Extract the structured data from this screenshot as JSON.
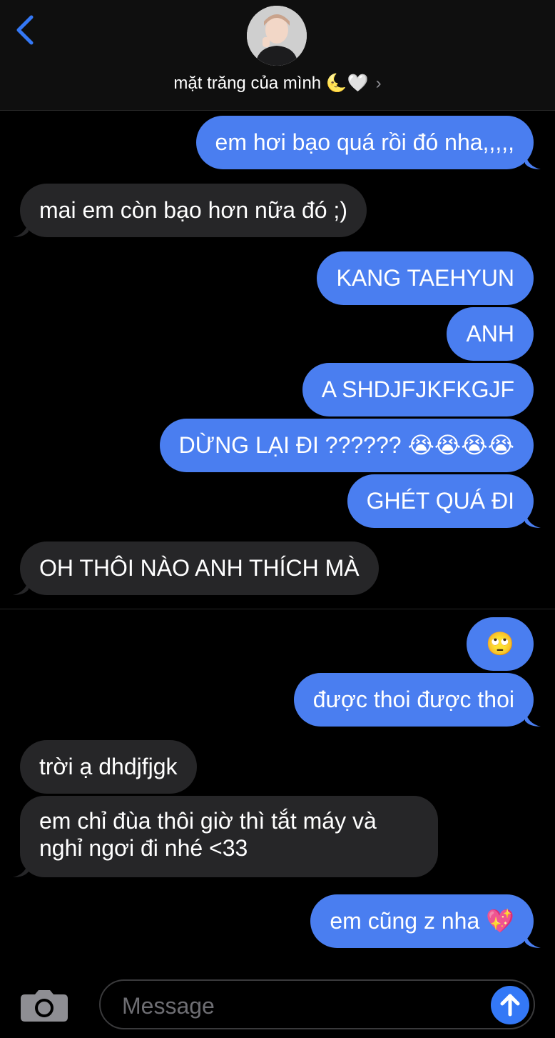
{
  "header": {
    "contact_name": "mặt trăng của mình 🌜🤍",
    "chevron": "›",
    "back_icon": "chevron-left-icon",
    "accent": "#3478f6"
  },
  "messages": [
    {
      "from": "me",
      "text": "em hơi bạo quá rồi đó nha,,,,,"
    },
    {
      "from": "them",
      "text": "mai em còn bạo hơn nữa đó ;)"
    },
    {
      "from": "me",
      "text": "KANG TAEHYUN"
    },
    {
      "from": "me",
      "text": "ANH"
    },
    {
      "from": "me",
      "text": "A SHDJFJKFKGJF"
    },
    {
      "from": "me",
      "text": "DỪNG LẠI ĐI ?????? 😭😭😭😭"
    },
    {
      "from": "me",
      "text": "GHÉT QUÁ ĐI"
    },
    {
      "from": "them",
      "text": "OH THÔI NÀO ANH THÍCH MÀ"
    },
    {
      "from": "me",
      "text": "🙄"
    },
    {
      "from": "me",
      "text": "được thoi được thoi"
    },
    {
      "from": "them",
      "text": "trời ạ dhdjfjgk"
    },
    {
      "from": "them",
      "text": "em chỉ đùa thôi giờ thì tắt máy và nghỉ ngơi đi nhé <33"
    },
    {
      "from": "me",
      "text": "em cũng z nha 💖"
    }
  ],
  "colors": {
    "sent_bubble": "#4a7ef0",
    "received_bubble": "#262628",
    "background": "#000000"
  },
  "input": {
    "placeholder": "Message",
    "camera_icon": "camera-icon",
    "send_icon": "arrow-up-icon"
  }
}
